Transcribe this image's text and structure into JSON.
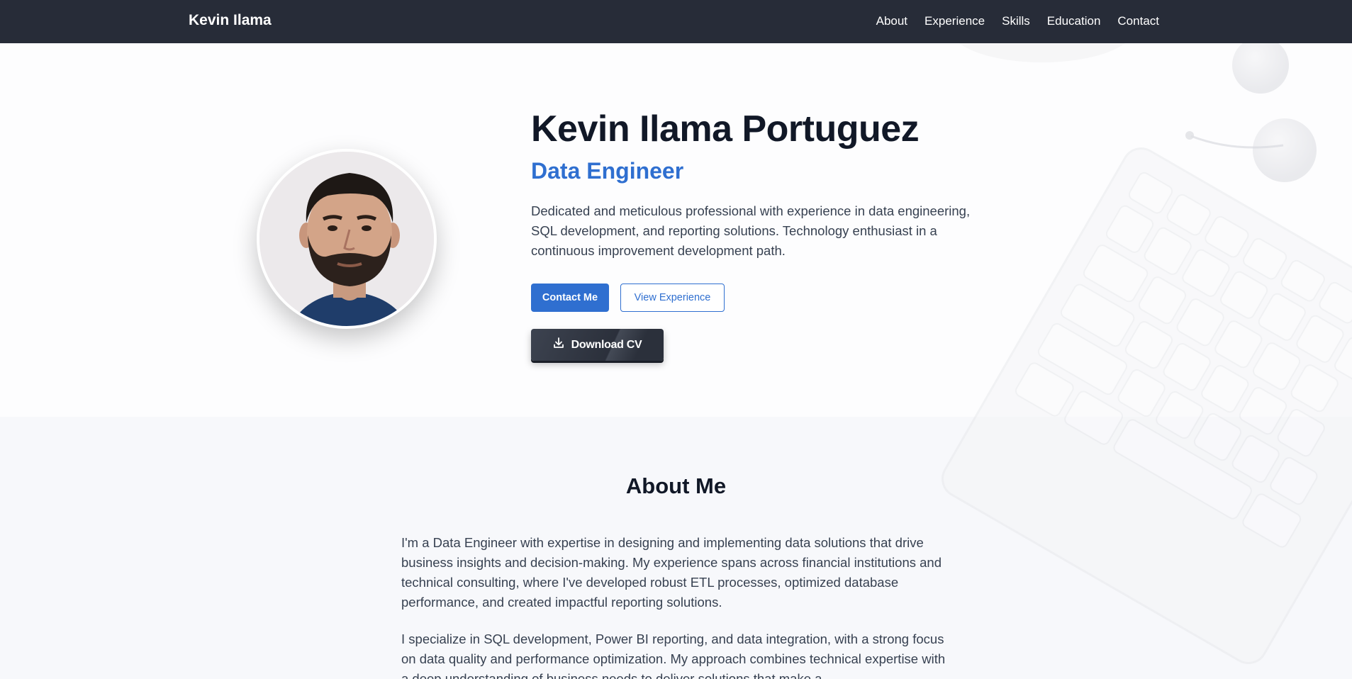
{
  "nav": {
    "brand": "Kevin Ilama",
    "links": [
      "About",
      "Experience",
      "Skills",
      "Education",
      "Contact"
    ]
  },
  "hero": {
    "name": "Kevin Ilama Portuguez",
    "role": "Data Engineer",
    "description": "Dedicated and meticulous professional with experience in data engineering, SQL development, and reporting solutions. Technology enthusiast in a continuous improvement development path.",
    "contact_button": "Contact Me",
    "experience_button": "View Experience",
    "download_button": "Download CV",
    "download_icon": "download-icon",
    "avatar": "profile-photo"
  },
  "about": {
    "title": "About Me",
    "paragraphs": [
      "I'm a Data Engineer with expertise in designing and implementing data solutions that drive business insights and decision-making. My experience spans across financial institutions and technical consulting, where I've developed robust ETL processes, optimized database performance, and created impactful reporting solutions.",
      "I specialize in SQL development, Power BI reporting, and data integration, with a strong focus on data quality and performance optimization. My approach combines technical expertise with a deep understanding of business needs to deliver solutions that make a"
    ]
  },
  "colors": {
    "nav_bg": "#272c38",
    "accent": "#2f6fd0",
    "heading": "#111827",
    "text": "#374151",
    "about_bg": "#f7f8fb"
  }
}
